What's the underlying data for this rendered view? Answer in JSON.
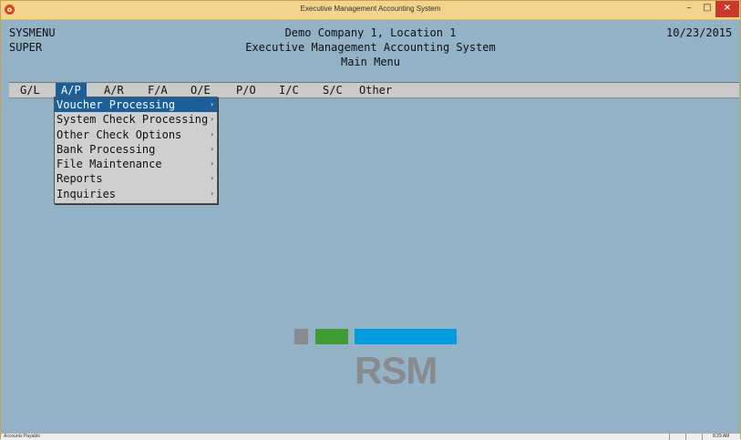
{
  "window": {
    "title": "Executive Management Accounting System",
    "icon": "app-logo-icon",
    "controls": {
      "minimize": "–",
      "maximize": "□",
      "close": "×"
    }
  },
  "header": {
    "left_line1": "SYSMENU",
    "left_line2": "SUPER",
    "center_line1": "Demo Company 1, Location 1",
    "center_line2": "Executive Management Accounting System",
    "center_line3": "Main Menu",
    "date": "10/23/2015"
  },
  "menubar": {
    "items": [
      {
        "label": "G/L",
        "active": false
      },
      {
        "label": "A/P",
        "active": true
      },
      {
        "label": "A/R",
        "active": false
      },
      {
        "label": "F/A",
        "active": false
      },
      {
        "label": "O/E",
        "active": false
      },
      {
        "label": "P/O",
        "active": false
      },
      {
        "label": "I/C",
        "active": false
      },
      {
        "label": "S/C",
        "active": false
      },
      {
        "label": "Other",
        "active": false
      }
    ]
  },
  "dropdown": {
    "items": [
      {
        "label": "Voucher Processing",
        "active": true
      },
      {
        "label": "System Check Processing",
        "active": false
      },
      {
        "label": "Other Check Options",
        "active": false
      },
      {
        "label": "Bank Processing",
        "active": false
      },
      {
        "label": "File Maintenance",
        "active": false
      },
      {
        "label": "Reports",
        "active": false
      },
      {
        "label": "Inquiries",
        "active": false
      }
    ],
    "submenu_arrow": "›"
  },
  "logo": {
    "text": "RSM",
    "colors": [
      "#888b8d",
      "#3f9c35",
      "#009cde"
    ]
  },
  "statusbar": {
    "left": "Accounts Payable",
    "right": "8:29 AM"
  },
  "colors": {
    "background": "#93b2c6",
    "highlight": "#1b5f9a",
    "titlebar": "#f2d58a"
  }
}
